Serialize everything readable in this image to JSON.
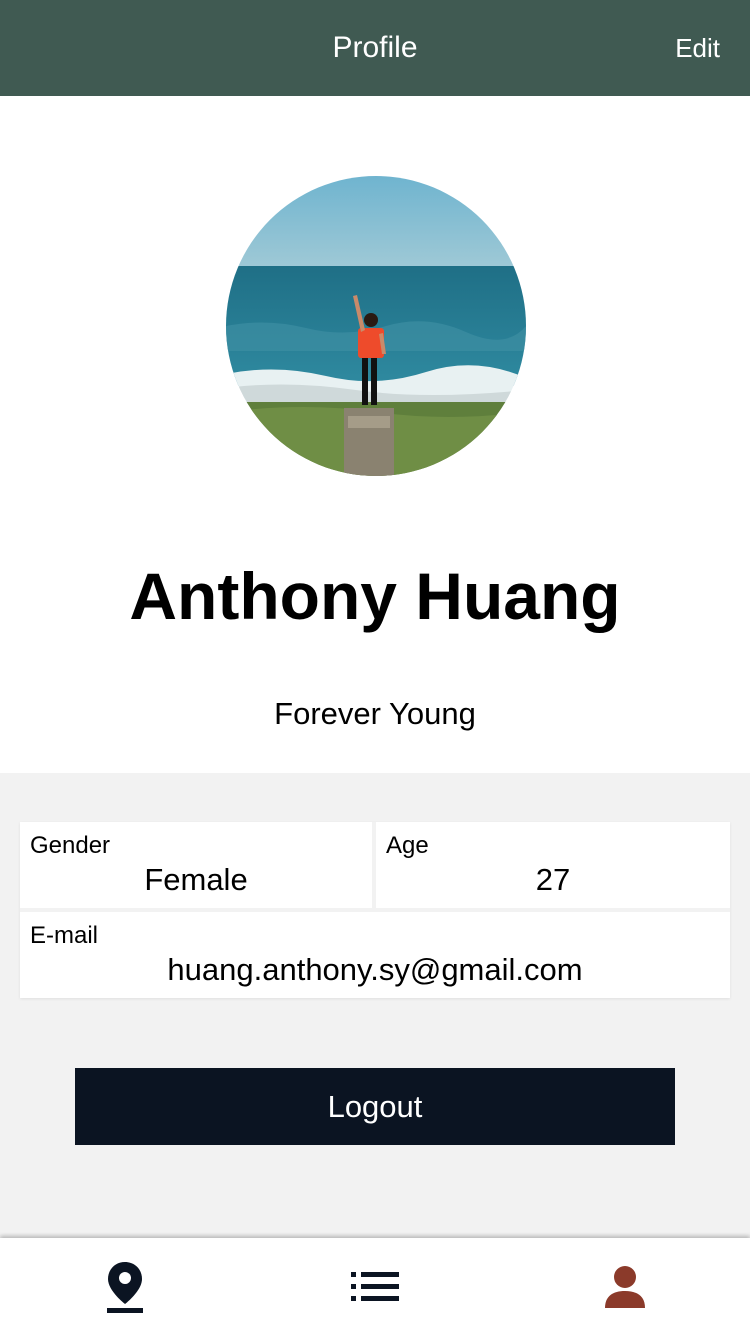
{
  "header": {
    "title": "Profile",
    "edit_label": "Edit"
  },
  "profile": {
    "name": "Anthony Huang",
    "tagline": "Forever Young",
    "avatar_icon": "avatar-photo"
  },
  "info": {
    "gender": {
      "label": "Gender",
      "value": "Female"
    },
    "age": {
      "label": "Age",
      "value": "27"
    },
    "email": {
      "label": "E-mail",
      "value": "huang.anthony.sy@gmail.com"
    }
  },
  "actions": {
    "logout_label": "Logout"
  },
  "tabs": [
    {
      "name": "map",
      "icon": "map-pin-icon",
      "active": true
    },
    {
      "name": "list",
      "icon": "list-icon",
      "active": false
    },
    {
      "name": "profile",
      "icon": "person-icon",
      "active": false
    }
  ],
  "colors": {
    "header_bg": "#405a52",
    "button_bg": "#0b1422",
    "profile_tab_icon": "#8b3a2a",
    "background": "#f2f2f2"
  }
}
